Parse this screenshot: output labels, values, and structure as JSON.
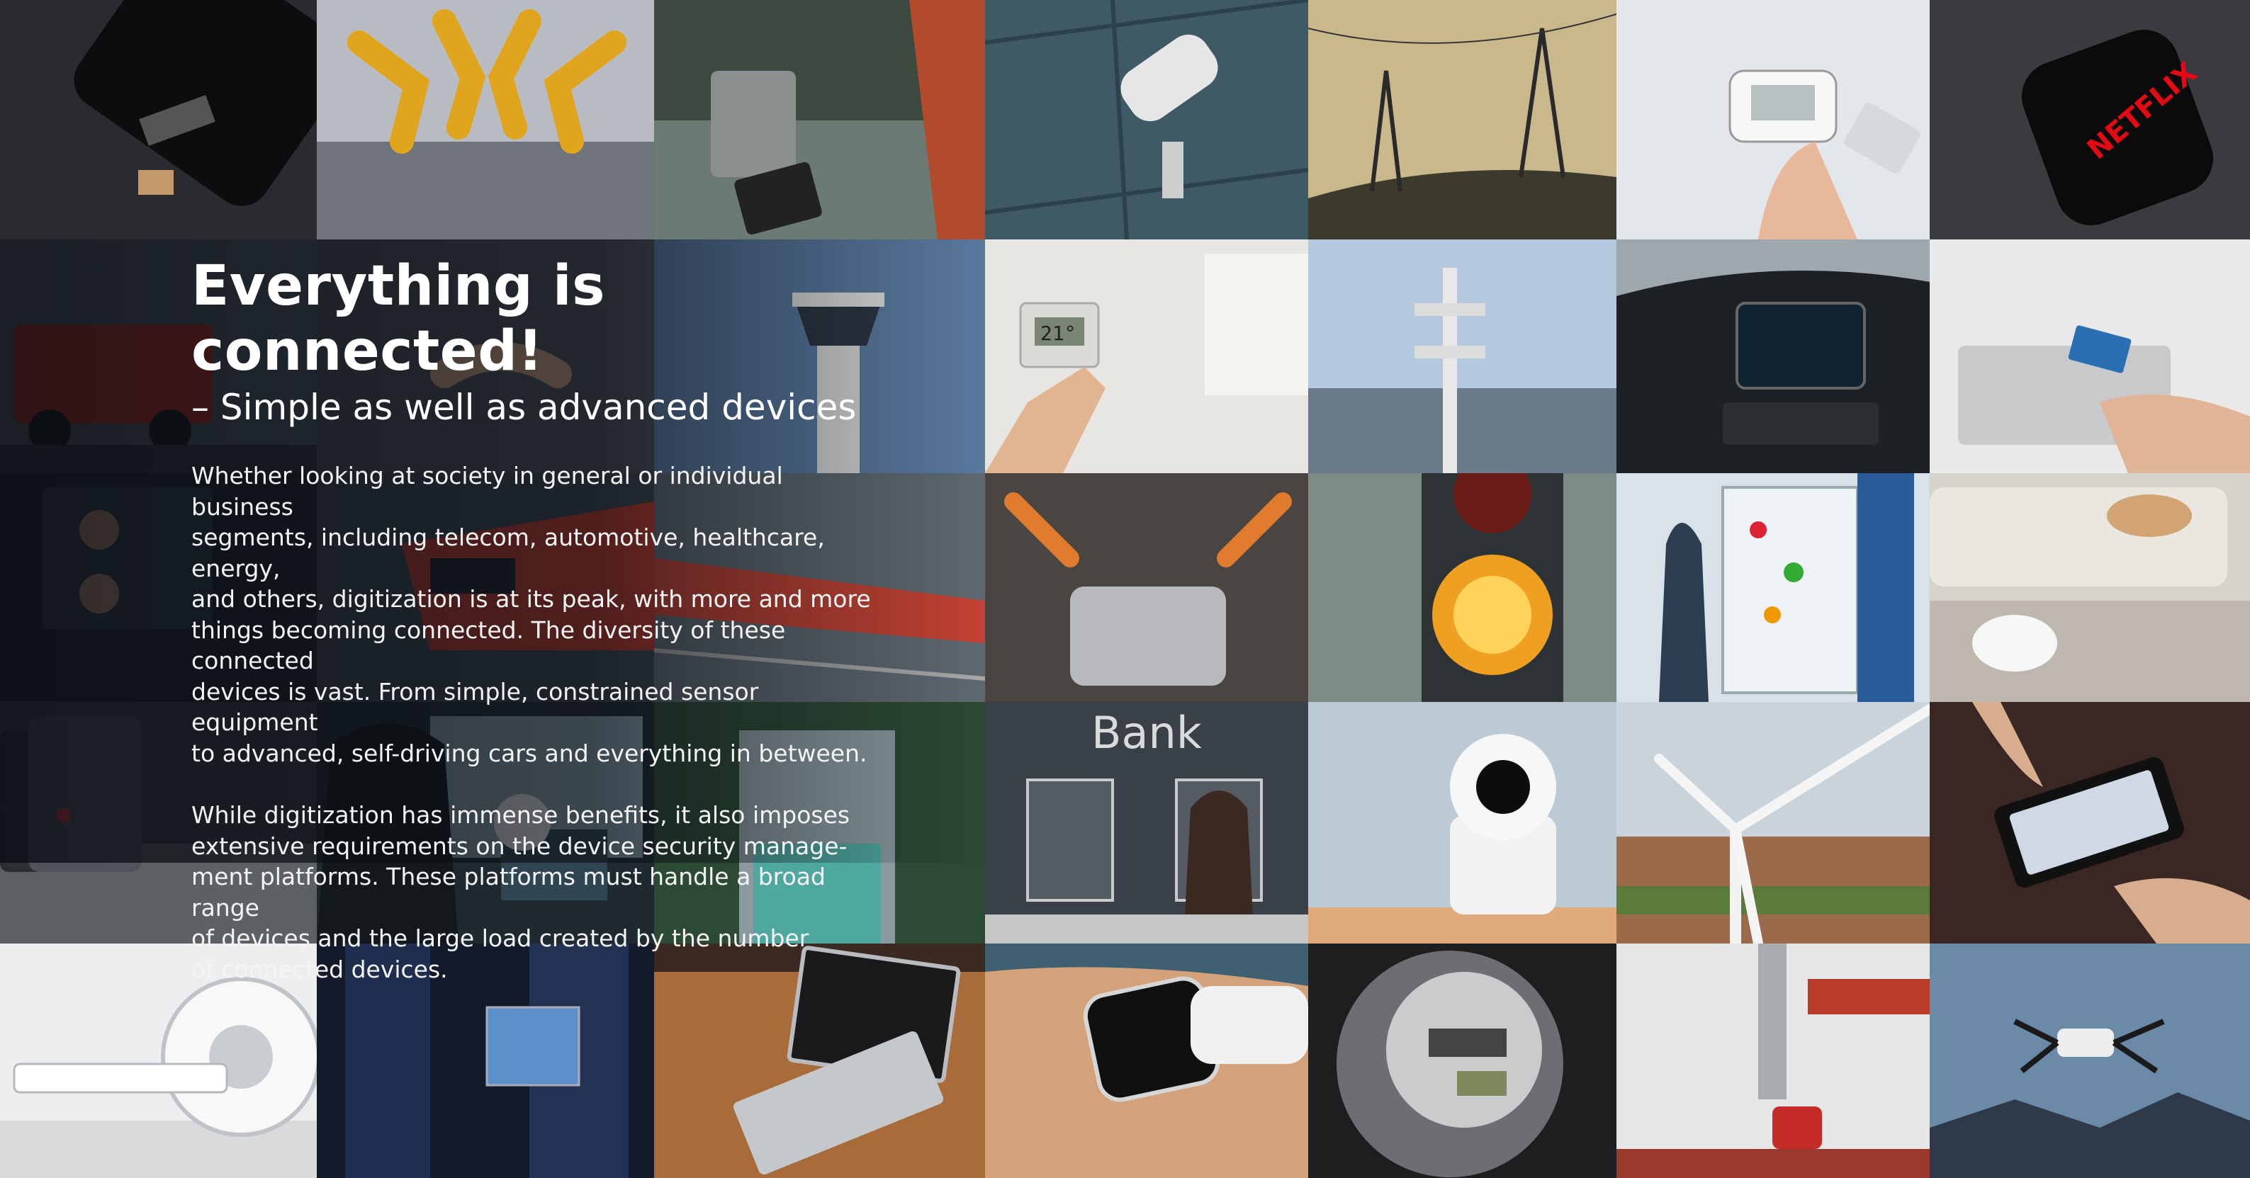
{
  "heading": {
    "title": "Everything is connected!",
    "subtitle": "– Simple as well as advanced devices"
  },
  "body": {
    "paragraph_1": "Whether looking at society in general or individual business\nsegments, including telecom, automotive, healthcare, energy,\nand others, digitization is at its peak, with more and more\nthings becoming connected. The diversity of these connected\ndevices is vast. From simple, constrained sensor equipment\nto advanced, self-driving cars and everything in between.",
    "paragraph_2": "While digitization has immense benefits, it also imposes\nextensive requirements on the device security manage-\nment platforms. These platforms must handle a broad range\nof devices and the large load created by the number\nof connected devices."
  },
  "photo_labels": {
    "bank_sign": "Bank",
    "thermostat": "21°",
    "watch_brand": "NETFLIX"
  },
  "colors": {
    "text": "#ffffff",
    "overlay": "#0a0e14",
    "netflix_red": "#e50914"
  }
}
